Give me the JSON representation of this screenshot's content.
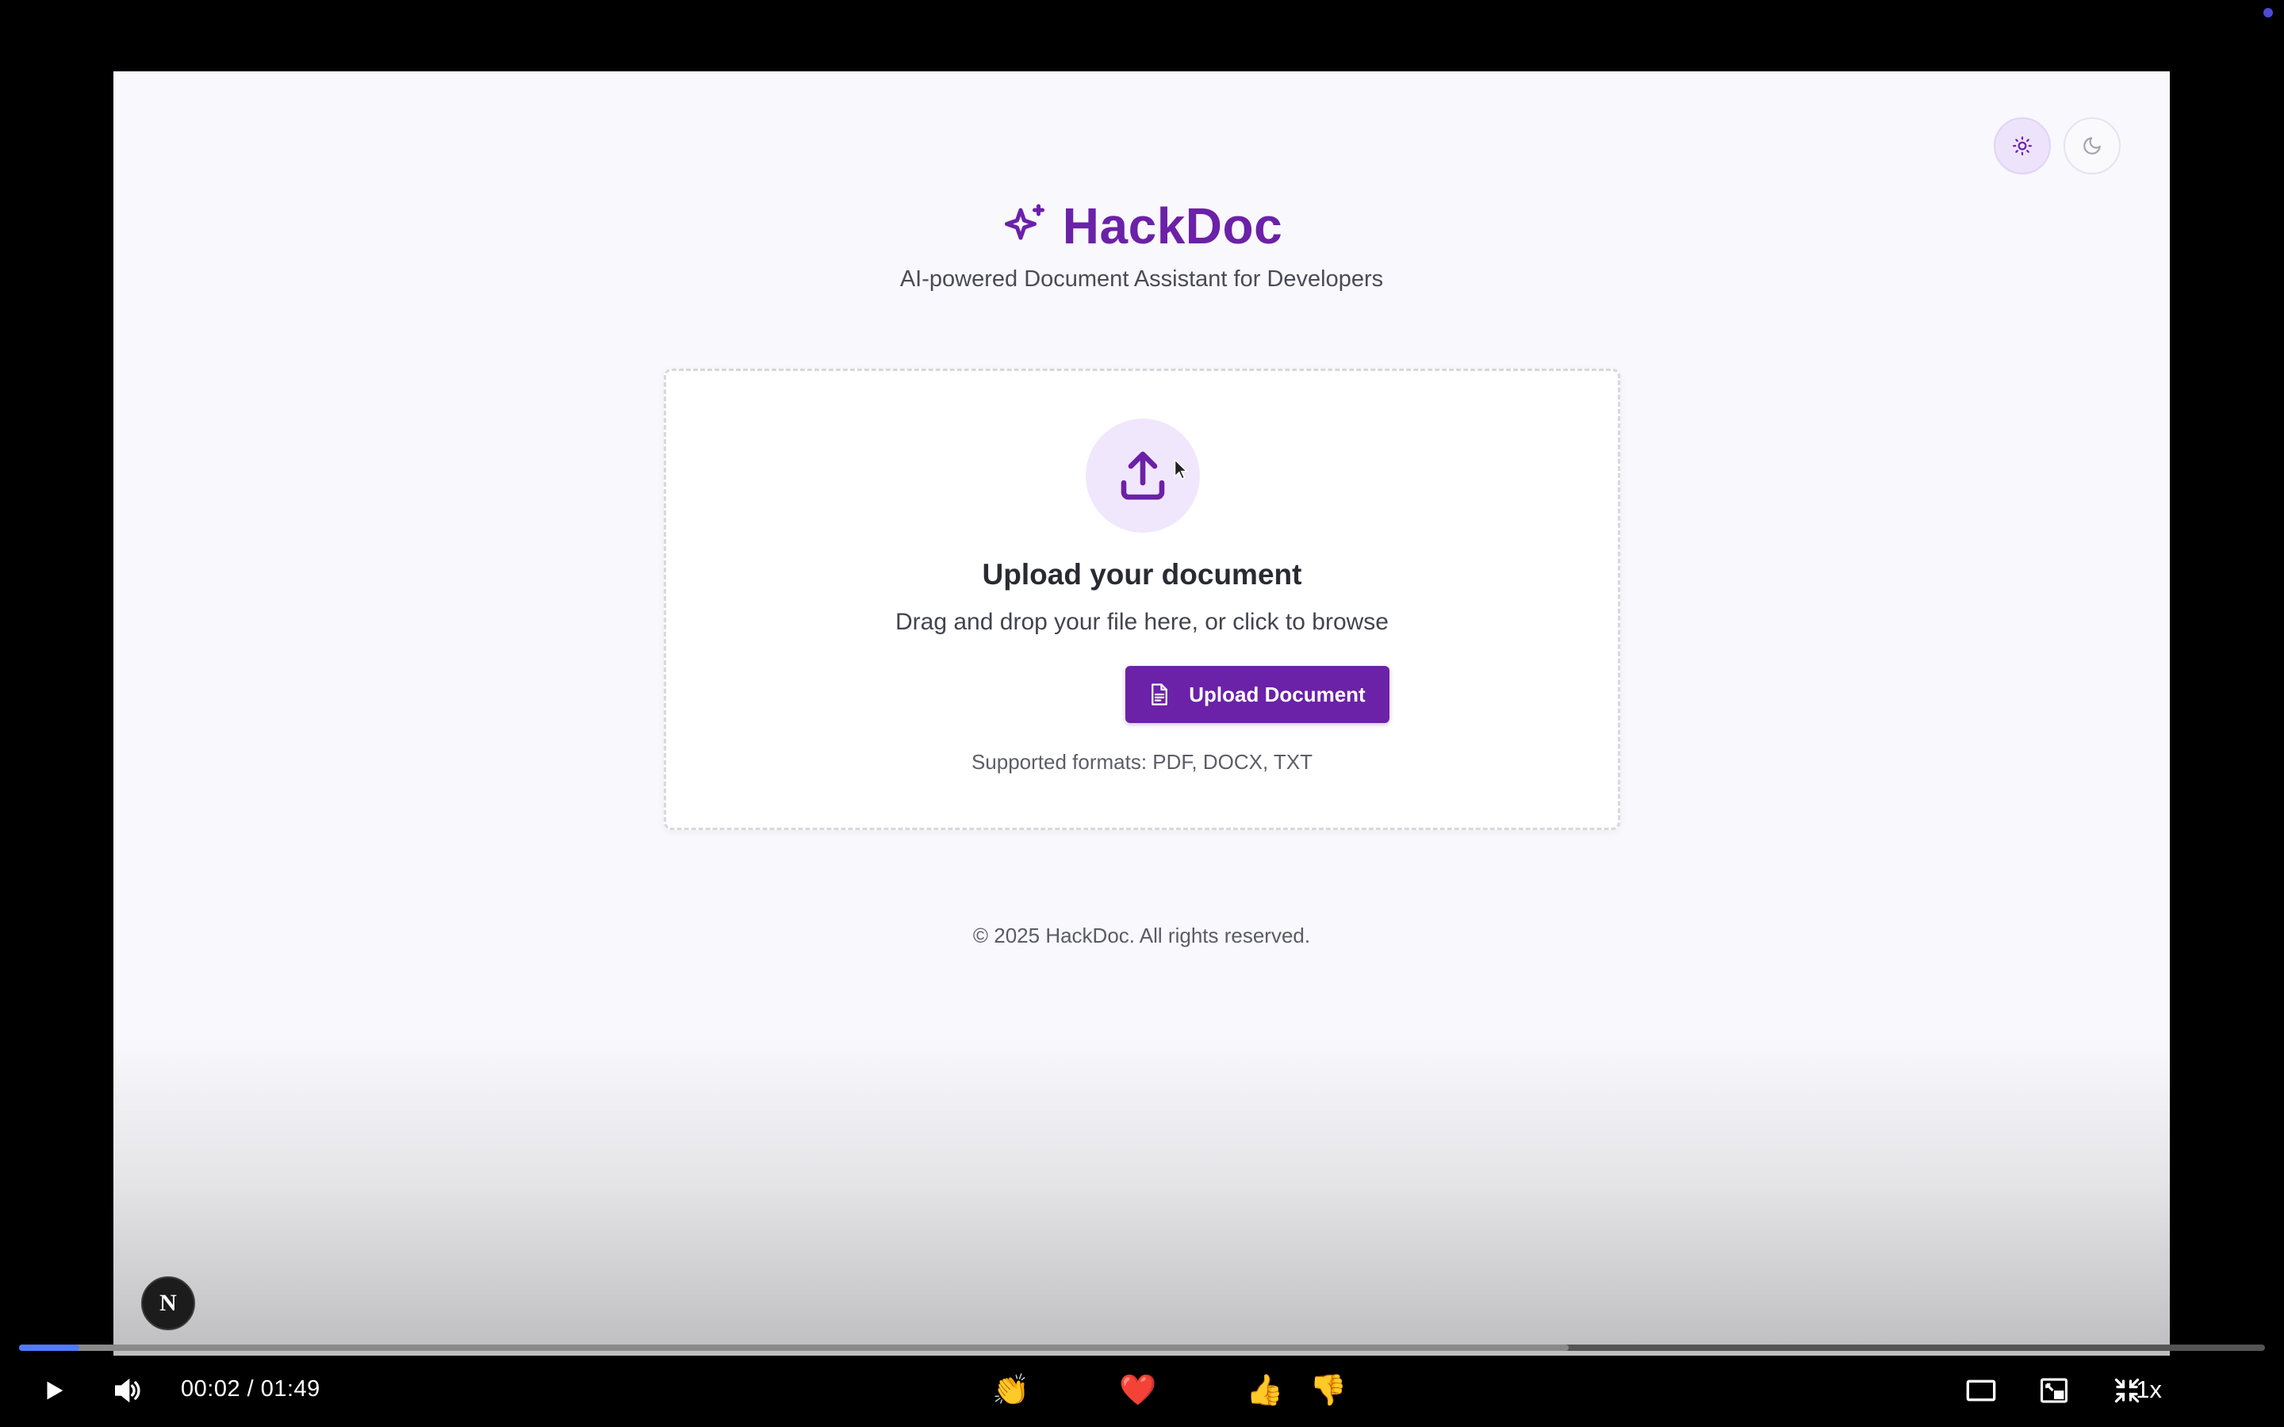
{
  "app": {
    "brand_title": "HackDoc",
    "subtitle": "AI-powered Document Assistant for Developers",
    "theme_toggle": {
      "light_icon": "sun-icon",
      "dark_icon": "moon-icon",
      "active": "light"
    },
    "upload": {
      "title": "Upload your document",
      "instructions": "Drag and drop your file here, or click to browse",
      "button_label": "Upload Document",
      "formats": "Supported formats: PDF, DOCX, TXT"
    },
    "footer": "© 2025 HackDoc. All rights reserved.",
    "badge_letter": "N"
  },
  "player": {
    "time": "00:02 / 01:49",
    "progress_played": 0.027,
    "progress_buffered": 0.69,
    "speed": "1x",
    "reactions": [
      "👏",
      "😂",
      "❤️",
      "😮",
      "👍",
      "👎"
    ]
  },
  "colors": {
    "brand": "#6b21a8",
    "accent_light": "#f1e7fd",
    "progress": "#4f7cff"
  }
}
